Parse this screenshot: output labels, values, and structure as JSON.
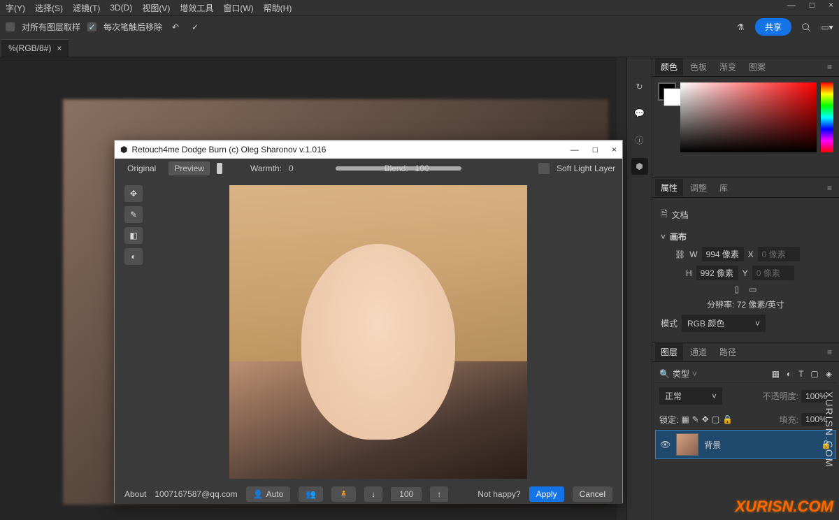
{
  "menu": {
    "items": [
      "字(Y)",
      "选择(S)",
      "滤镜(T)",
      "3D(D)",
      "视图(V)",
      "增效工具",
      "窗口(W)",
      "帮助(H)"
    ]
  },
  "toolbar": {
    "opt1": "对所有图层取样",
    "opt2": "每次笔触后移除",
    "share": "共享"
  },
  "doc_tab": {
    "name": "%(RGB/8#)",
    "close": "×"
  },
  "color_panel": {
    "tabs": [
      "颜色",
      "色板",
      "渐变",
      "图案"
    ]
  },
  "props_panel": {
    "tabs": [
      "属性",
      "调整",
      "库"
    ],
    "doc_label": "文档",
    "canvas_label": "画布",
    "w_label": "W",
    "w_val": "994 像素",
    "x_label": "X",
    "x_val": "0 像素",
    "h_label": "H",
    "h_val": "992 像素",
    "y_label": "Y",
    "y_val": "0 像素",
    "res": "分辨率: 72 像素/英寸",
    "mode_label": "模式",
    "mode_val": "RGB 颜色"
  },
  "layers_panel": {
    "tabs": [
      "图层",
      "通道",
      "路径"
    ],
    "search": "类型",
    "blend": "正常",
    "opacity_label": "不透明度:",
    "opacity": "100%",
    "lock_label": "锁定:",
    "fill_label": "填充:",
    "fill": "100%",
    "layer_name": "背景"
  },
  "plugin": {
    "title": "Retouch4me Dodge Burn (c) Oleg Sharonov v.1.016",
    "original": "Original",
    "preview": "Preview",
    "warmth_label": "Warmth:",
    "warmth_val": "0",
    "blend_label": "Blend:",
    "blend_val": "100",
    "soft_light": "Soft Light Layer",
    "about": "About",
    "email": "1007167587@qq.com",
    "auto": "Auto",
    "val": "100",
    "not_happy": "Not happy?",
    "apply": "Apply",
    "cancel": "Cancel"
  },
  "watermark": "XURISN.COM",
  "watermark_v": "XURISN.COM"
}
